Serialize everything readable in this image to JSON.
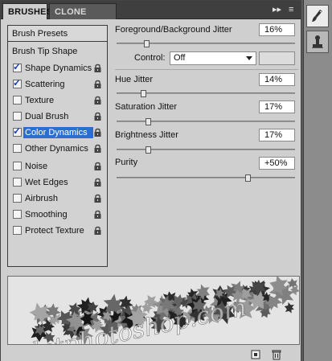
{
  "tabs": [
    {
      "label": "BRUSHES"
    },
    {
      "label": "CLONE SOURCE"
    }
  ],
  "tab_controls": {
    "expand": "▸▸",
    "menu": "≡"
  },
  "left_list": {
    "presets_label": "Brush Presets",
    "tip_label": "Brush Tip Shape",
    "items": [
      {
        "label": "Shape Dynamics",
        "checked": true
      },
      {
        "label": "Scattering",
        "checked": true
      },
      {
        "label": "Texture",
        "checked": false
      },
      {
        "label": "Dual Brush",
        "checked": false
      },
      {
        "label": "Color Dynamics",
        "checked": true,
        "selected": true
      },
      {
        "label": "Other Dynamics",
        "checked": false
      },
      {
        "label": "Noise",
        "checked": false
      },
      {
        "label": "Wet Edges",
        "checked": false
      },
      {
        "label": "Airbrush",
        "checked": false
      },
      {
        "label": "Smoothing",
        "checked": false
      },
      {
        "label": "Protect Texture",
        "checked": false
      }
    ]
  },
  "params": {
    "fg_bg_jitter": {
      "label": "Foreground/Background Jitter",
      "value": "16%",
      "level": 0.16
    },
    "control": {
      "label": "Control:",
      "value": "Off"
    },
    "hue_jitter": {
      "label": "Hue Jitter",
      "value": "14%",
      "level": 0.14
    },
    "saturation_jitter": {
      "label": "Saturation Jitter",
      "value": "17%",
      "level": 0.17
    },
    "brightness_jitter": {
      "label": "Brightness Jitter",
      "value": "17%",
      "level": 0.17
    },
    "purity": {
      "label": "Purity",
      "value": "+50%",
      "level": 0.75
    }
  },
  "preview": {
    "watermark": "idetphotoshop.com"
  },
  "colors": {
    "accent": "#2a6fcf",
    "panel": "#cfcfcf",
    "tabbar": "#3f3f3f"
  }
}
